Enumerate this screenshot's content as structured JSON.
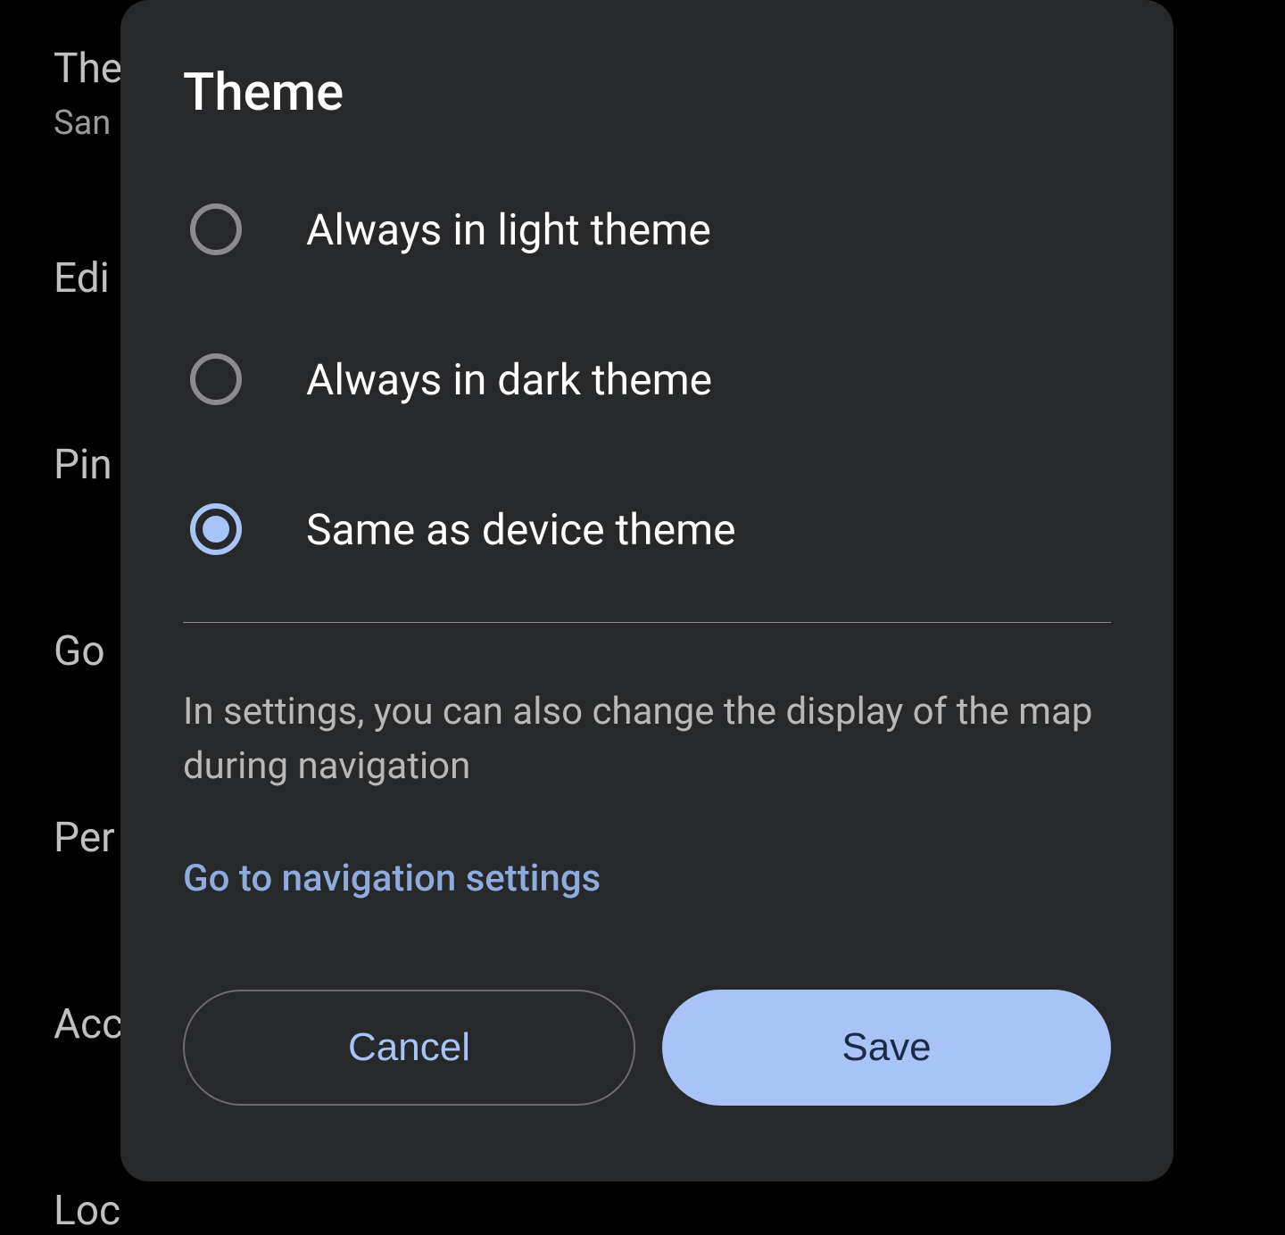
{
  "background": {
    "items": [
      {
        "title": "The",
        "subtitle": "San"
      },
      {
        "title": "Edi"
      },
      {
        "title": "Pin"
      },
      {
        "title": "Go"
      },
      {
        "title": "Per"
      },
      {
        "title": "Acc"
      },
      {
        "title": "Loc"
      }
    ]
  },
  "dialog": {
    "title": "Theme",
    "options": [
      {
        "label": "Always in light theme",
        "selected": false
      },
      {
        "label": "Always in dark theme",
        "selected": false
      },
      {
        "label": "Same as device theme",
        "selected": true
      }
    ],
    "helpText": "In settings, you can also change the display of the map during navigation",
    "link": "Go to navigation settings",
    "cancelLabel": "Cancel",
    "saveLabel": "Save"
  }
}
